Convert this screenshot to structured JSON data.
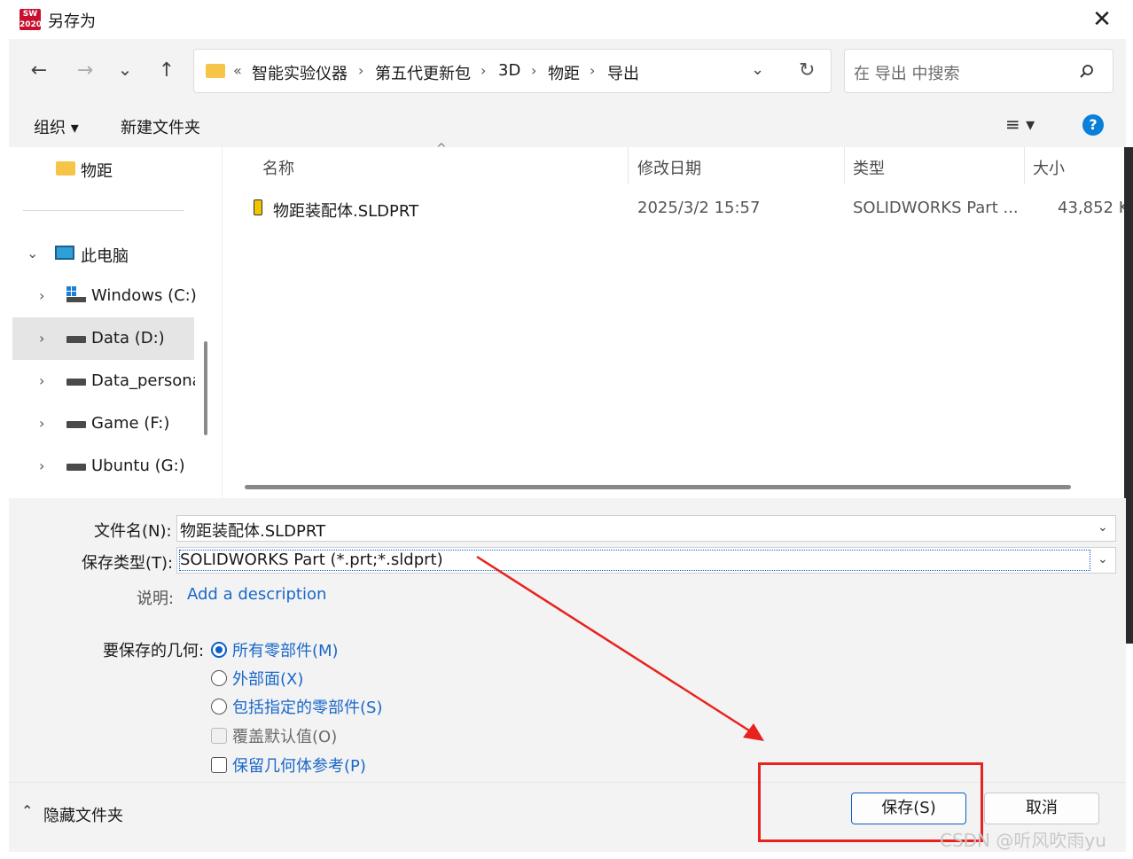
{
  "window": {
    "title": "另存为",
    "app_logo_text": "SW 2020",
    "close_glyph": "✕"
  },
  "nav": {
    "back": "←",
    "forward": "→",
    "recent": "⌄",
    "up": "↑",
    "breadcrumb_prefix": "«",
    "breadcrumb": [
      "智能实验仪器",
      "第五代更新包",
      "3D",
      "物距",
      "导出"
    ],
    "refresh": "↻",
    "search_placeholder": "在 导出 中搜索"
  },
  "toolbar": {
    "organize": "组织 ▾",
    "new_folder": "新建文件夹",
    "view": "≡ ▾",
    "help": "?"
  },
  "sidebar": {
    "pinned_folder": "物距",
    "this_pc": "此电脑",
    "drives": [
      {
        "label": "Windows (C:)"
      },
      {
        "label": "Data (D:)"
      },
      {
        "label": "Data_persona"
      },
      {
        "label": "Game (F:)"
      },
      {
        "label": "Ubuntu (G:)"
      }
    ]
  },
  "filelist": {
    "columns": [
      "名称",
      "修改日期",
      "类型",
      "大小"
    ],
    "rows": [
      {
        "name": "物距装配体.SLDPRT",
        "date": "2025/3/2 15:57",
        "type": "SOLIDWORKS Part ...",
        "size": "43,852 K"
      }
    ]
  },
  "form": {
    "filename_label": "文件名(N):",
    "filename_value": "物距装配体.SLDPRT",
    "filetype_label": "保存类型(T):",
    "filetype_value": "SOLIDWORKS Part (*.prt;*.sldprt)",
    "desc_label": "说明:",
    "desc_link": "Add a description",
    "geometry_label": "要保存的几何:",
    "options": [
      {
        "label": "所有零部件(M)"
      },
      {
        "label": "外部面(X)"
      },
      {
        "label": "包括指定的零部件(S)"
      },
      {
        "label": "覆盖默认值(O)"
      },
      {
        "label": "保留几何体参考(P)"
      }
    ]
  },
  "footer": {
    "hide_folders": "隐藏文件夹",
    "save": "保存(S)",
    "cancel": "取消"
  },
  "watermark": "CSDN @听风吹雨yu",
  "colors": {
    "accent": "#0a5fc4",
    "annotation": "#e8221d"
  }
}
